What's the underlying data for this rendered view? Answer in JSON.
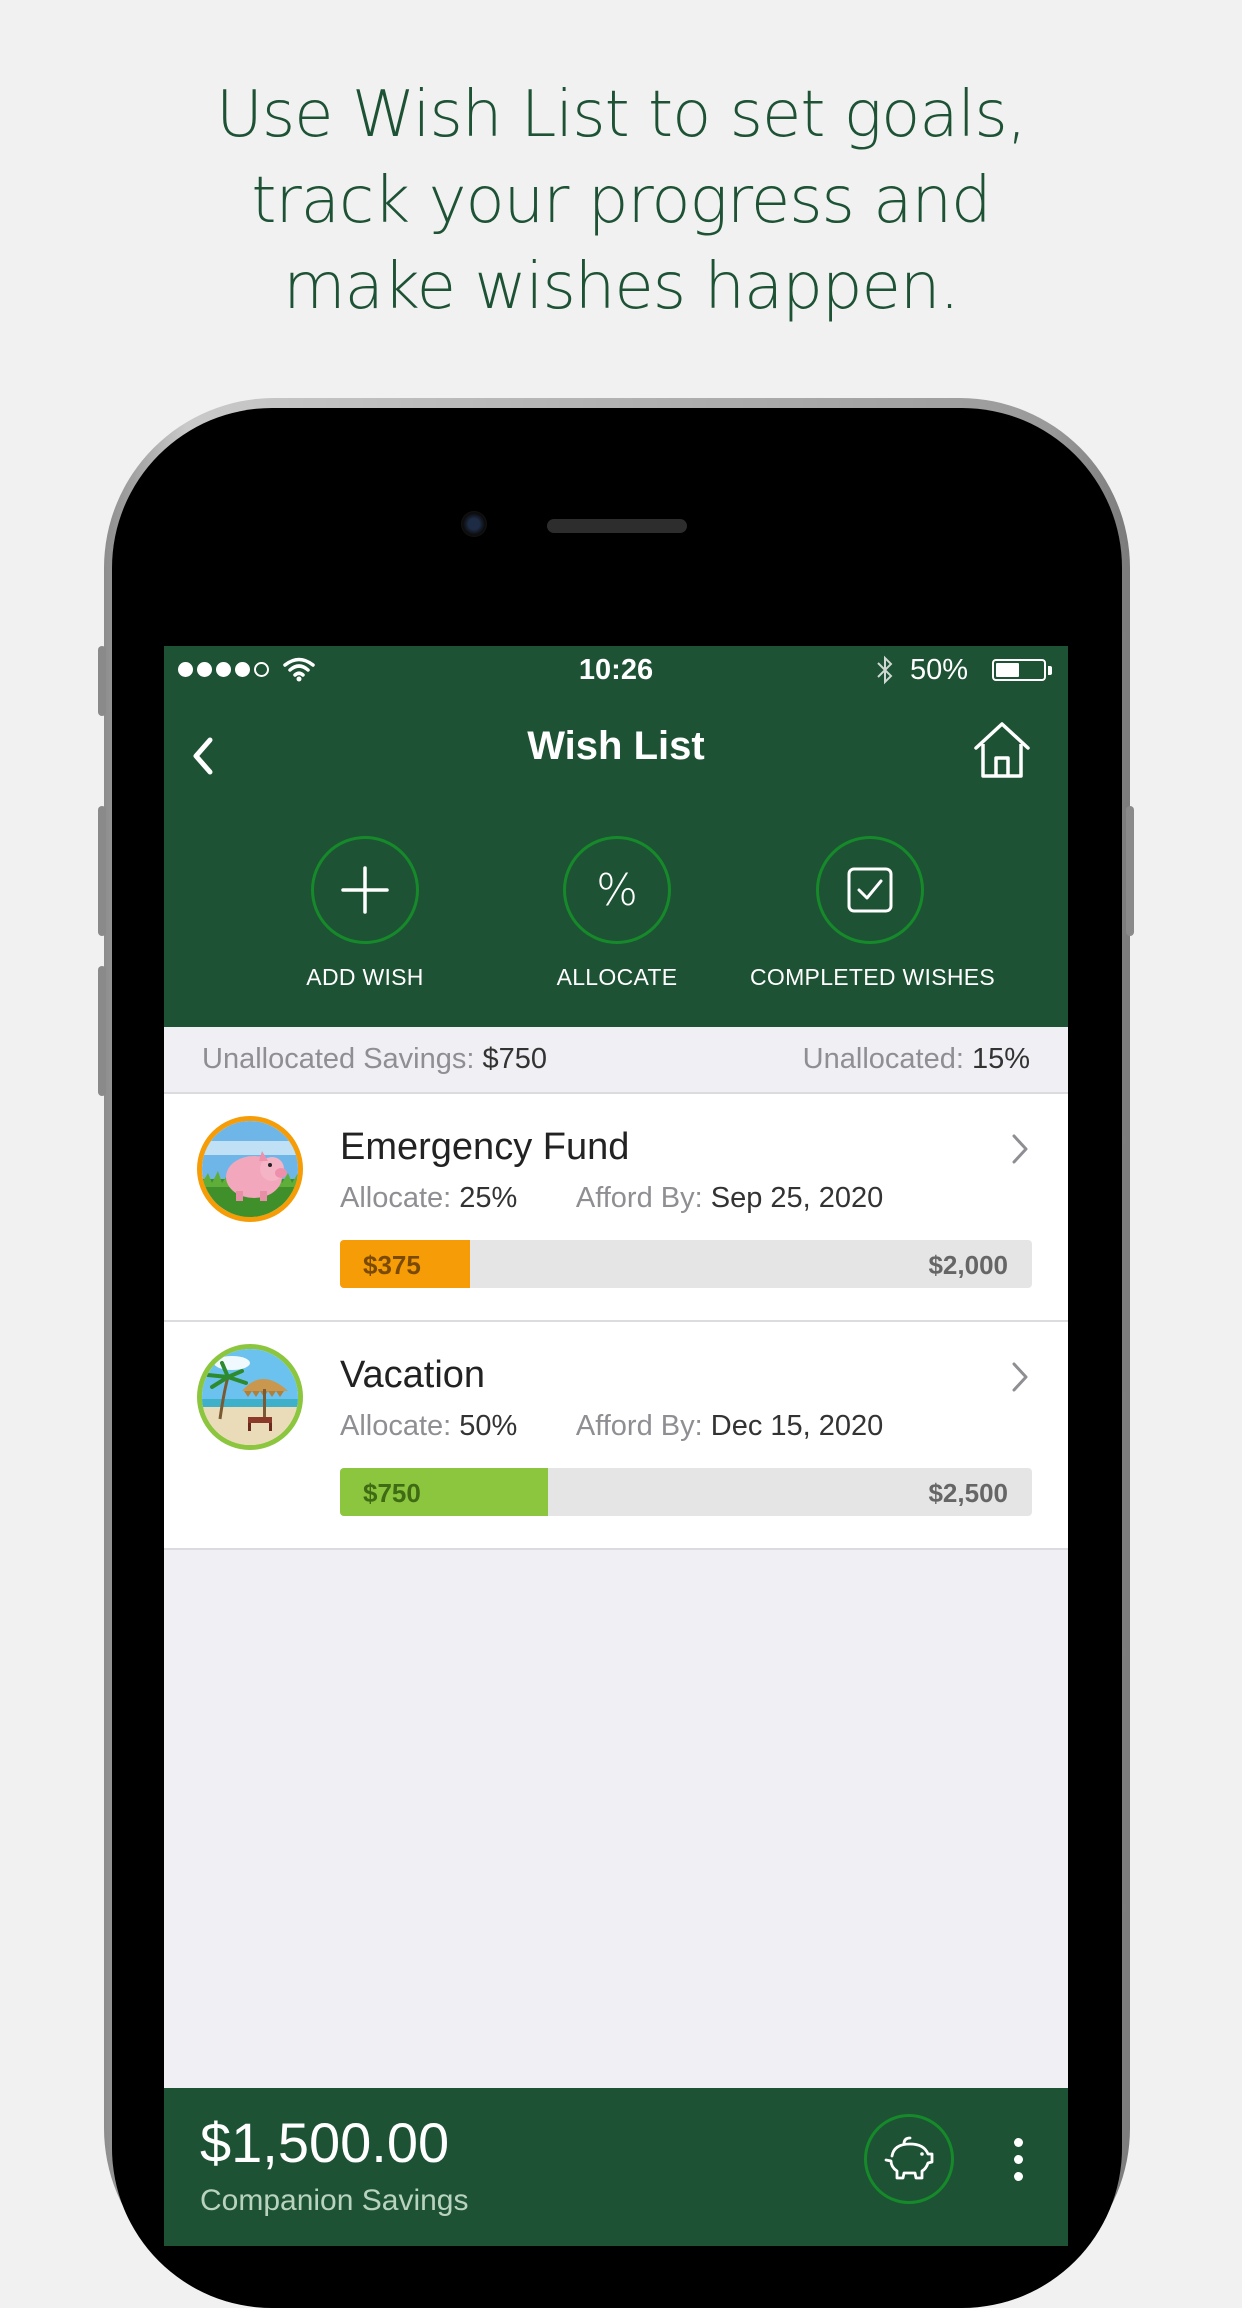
{
  "headline": {
    "line1": "Use Wish List to set goals,",
    "line2": "track your progress and",
    "line3": "make wishes happen."
  },
  "status_bar": {
    "time": "10:26",
    "battery": "50%",
    "battery_level": 0.5
  },
  "nav": {
    "title": "Wish List",
    "back_icon": "chevron-left-icon",
    "home_icon": "home-icon"
  },
  "actions": [
    {
      "label": "ADD WISH",
      "icon": "plus-icon"
    },
    {
      "label": "ALLOCATE",
      "icon": "percent-icon",
      "glyph": "%"
    },
    {
      "label": "COMPLETED WISHES",
      "icon": "checkbox-icon"
    }
  ],
  "unallocated": {
    "savings_label": "Unallocated Savings:",
    "savings_value": "$750",
    "percent_label": "Unallocated:",
    "percent_value": "15%"
  },
  "wishes": [
    {
      "name": "Emergency Fund",
      "allocate_label": "Allocate:",
      "allocate_value": "25%",
      "afford_label": "Afford By:",
      "afford_value": "Sep 25, 2020",
      "saved": "$375",
      "goal": "$2,000",
      "progress": 0.1875,
      "color": "#f59c06",
      "image": "piggy-bank-image"
    },
    {
      "name": "Vacation",
      "allocate_label": "Allocate:",
      "allocate_value": "50%",
      "afford_label": "Afford By:",
      "afford_value": "Dec 15, 2020",
      "saved": "$750",
      "goal": "$2,500",
      "progress": 0.3,
      "color": "#8cc63f",
      "image": "beach-umbrella-image"
    }
  ],
  "footer": {
    "amount": "$1,500.00",
    "label": "Companion Savings"
  },
  "colors": {
    "brand_green": "#1d5234",
    "ring_green": "#168a2a",
    "headline_green": "#1d5234"
  }
}
